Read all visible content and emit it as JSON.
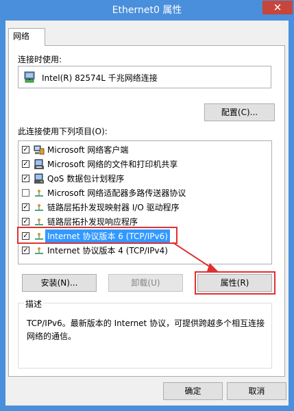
{
  "window": {
    "title": "Ethernet0 属性",
    "close": "✕"
  },
  "tab": {
    "label": "网络"
  },
  "connect_using": {
    "label": "连接时使用:",
    "adapter": "Intel(R) 82574L 千兆网络连接"
  },
  "buttons": {
    "configure": "配置(C)...",
    "install": "安装(N)...",
    "uninstall": "卸载(U)",
    "properties": "属性(R)",
    "ok": "确定",
    "cancel": "取消"
  },
  "items_label": "此连接使用下列项目(O):",
  "items": [
    {
      "label": "Microsoft 网络客户端",
      "checked": true,
      "icon": "network-client-icon"
    },
    {
      "label": "Microsoft 网络的文件和打印机共享",
      "checked": true,
      "icon": "file-printer-share-icon"
    },
    {
      "label": "QoS 数据包计划程序",
      "checked": true,
      "icon": "qos-icon"
    },
    {
      "label": "Microsoft 网络适配器多路传送器协议",
      "checked": false,
      "icon": "protocol-icon"
    },
    {
      "label": "链路层拓扑发现映射器 I/O 驱动程序",
      "checked": true,
      "icon": "protocol-icon"
    },
    {
      "label": "链路层拓扑发现响应程序",
      "checked": true,
      "icon": "protocol-icon"
    },
    {
      "label": "Internet 协议版本 6 (TCP/IPv6)",
      "checked": true,
      "icon": "protocol-icon",
      "selected": true
    },
    {
      "label": "Internet 协议版本 4 (TCP/IPv4)",
      "checked": true,
      "icon": "protocol-icon"
    }
  ],
  "description": {
    "title": "描述",
    "text": "TCP/IPv6。最新版本的 Internet 协议，可提供跨越多个相互连接网络的通信。"
  },
  "colors": {
    "title_bar": "#4a8fdb",
    "close": "#c7453b",
    "selection": "#3399ff",
    "highlight": "#e03030"
  }
}
